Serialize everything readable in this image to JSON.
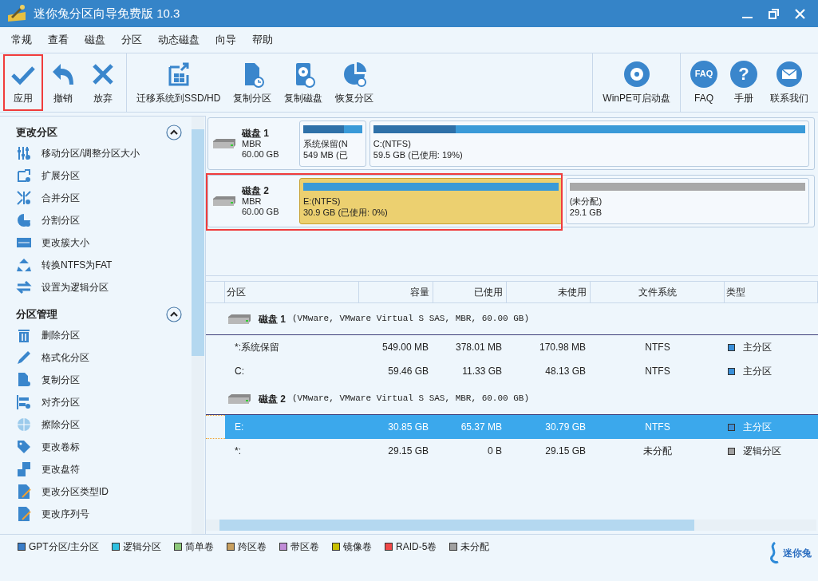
{
  "window": {
    "title": "迷你兔分区向导免费版 10.3"
  },
  "menu": [
    "常规",
    "查看",
    "磁盘",
    "分区",
    "动态磁盘",
    "向导",
    "帮助"
  ],
  "toolbar": {
    "groups": [
      [
        {
          "label": "应用",
          "highlighted": true
        },
        {
          "label": "撤销",
          "highlighted": false
        },
        {
          "label": "放弃",
          "highlighted": false
        }
      ],
      [
        {
          "label": "迁移系统到SSD/HD",
          "highlighted": false
        },
        {
          "label": "复制分区",
          "highlighted": false
        },
        {
          "label": "复制磁盘",
          "highlighted": false
        },
        {
          "label": "恢复分区",
          "highlighted": false
        }
      ],
      [
        {
          "label": "WinPE可启动盘",
          "highlighted": false
        }
      ],
      [
        {
          "label": "FAQ",
          "icon_text": "FAQ",
          "highlighted": false
        },
        {
          "label": "手册",
          "icon_text": "?",
          "highlighted": false
        },
        {
          "label": "联系我们",
          "highlighted": false
        }
      ]
    ]
  },
  "sidebar": {
    "sections": [
      {
        "title": "更改分区",
        "expanded": true,
        "items": [
          "移动分区/调整分区大小",
          "扩展分区",
          "合并分区",
          "分割分区",
          "更改簇大小",
          "转换NTFS为FAT",
          "设置为逻辑分区"
        ]
      },
      {
        "title": "分区管理",
        "expanded": true,
        "items": [
          "删除分区",
          "格式化分区",
          "复制分区",
          "对齐分区",
          "擦除分区",
          "更改卷标",
          "更改盘符",
          "更改分区类型ID",
          "更改序列号"
        ]
      }
    ]
  },
  "disk_map": [
    {
      "name": "磁盘 1",
      "scheme": "MBR",
      "size": "60.00 GB",
      "highlighted": false,
      "partitions": [
        {
          "kind": "partition",
          "label": "系统保留(N",
          "detail": "549 MB (已",
          "level": 0.69,
          "selected": false
        },
        {
          "kind": "partition",
          "label": "C:(NTFS)",
          "detail": "59.5 GB (已使用: 19%)",
          "level": 0.19,
          "selected": false
        }
      ]
    },
    {
      "name": "磁盘 2",
      "scheme": "MBR",
      "size": "60.00 GB",
      "highlighted": true,
      "partitions": [
        {
          "kind": "partition",
          "label": "E:(NTFS)",
          "detail": "30.9 GB (已使用: 0%)",
          "selected": true
        },
        {
          "kind": "unallocated",
          "label": "(未分配)",
          "detail": "29.1 GB",
          "selected": false
        }
      ]
    }
  ],
  "table": {
    "columns": [
      "分区",
      "容量",
      "已使用",
      "未使用",
      "文件系统",
      "类型"
    ],
    "groups": [
      {
        "disk": "磁盘 1",
        "detail": "(VMware, VMware Virtual S SAS, MBR, 60.00 GB)",
        "rows": [
          {
            "cells": [
              "*:系统保留",
              "549.00 MB",
              "378.01 MB",
              "170.98 MB",
              "NTFS",
              "主分区"
            ],
            "color": "#3a8fd8",
            "selected": false
          },
          {
            "cells": [
              "C:",
              "59.46 GB",
              "11.33 GB",
              "48.13 GB",
              "NTFS",
              "主分区"
            ],
            "color": "#3a8fd8",
            "selected": false
          }
        ]
      },
      {
        "disk": "磁盘 2",
        "detail": "(VMware, VMware Virtual S SAS, MBR, 60.00 GB)",
        "rows": [
          {
            "cells": [
              "E:",
              "30.85 GB",
              "65.37 MB",
              "30.79 GB",
              "NTFS",
              "主分区"
            ],
            "color": "#3a8fd8",
            "selected": true
          },
          {
            "cells": [
              "*:",
              "29.15 GB",
              "0 B",
              "29.15 GB",
              "未分配",
              "逻辑分区"
            ],
            "color": "#a0a0a0",
            "selected": false
          }
        ]
      }
    ]
  },
  "legend": [
    {
      "label": "GPT分区/主分区",
      "color": "#3a7dc9"
    },
    {
      "label": "逻辑分区",
      "color": "#2ec0e0"
    },
    {
      "label": "简单卷",
      "color": "#8cc87a"
    },
    {
      "label": "跨区卷",
      "color": "#c8a060"
    },
    {
      "label": "带区卷",
      "color": "#c08cd8"
    },
    {
      "label": "镜像卷",
      "color": "#c8c000"
    },
    {
      "label": "RAID-5卷",
      "color": "#f04848"
    },
    {
      "label": "未分配",
      "color": "#a0a0a0"
    }
  ],
  "brand": "迷你兔"
}
